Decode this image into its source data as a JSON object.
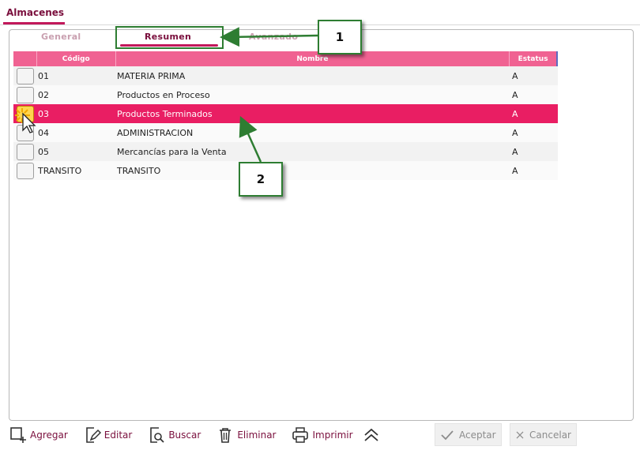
{
  "window": {
    "title": "Almacenes"
  },
  "tabs": [
    {
      "label": "General",
      "active": false
    },
    {
      "label": "Resumen",
      "active": true
    },
    {
      "label": "Avanzado",
      "active": false
    }
  ],
  "grid": {
    "headers": {
      "code": "Código",
      "name": "Nombre",
      "status": "Estatus"
    },
    "rows": [
      {
        "code": "01",
        "name": "MATERIA PRIMA",
        "status": "A",
        "selected": false
      },
      {
        "code": "02",
        "name": "Productos en Proceso",
        "status": "A",
        "selected": false
      },
      {
        "code": "03",
        "name": "Productos Terminados",
        "status": "A",
        "selected": true
      },
      {
        "code": "04",
        "name": "ADMINISTRACION",
        "status": "A",
        "selected": false
      },
      {
        "code": "05",
        "name": "Mercancías para la Venta",
        "status": "A",
        "selected": false
      },
      {
        "code": "TRANSITO",
        "name": "TRANSITO",
        "status": "A",
        "selected": false
      }
    ]
  },
  "toolbar": {
    "add_label": "Agregar",
    "edit_label": "Editar",
    "search_label": "Buscar",
    "delete_label": "Eliminar",
    "print_label": "Imprimir",
    "collapse_icon": "double-chevron-up-icon"
  },
  "actions": {
    "accept_label": "Aceptar",
    "cancel_label": "Cancelar"
  },
  "callouts": [
    {
      "label": "1"
    },
    {
      "label": "2"
    }
  ],
  "colors": {
    "accent": "#e91e63",
    "header": "#f06292",
    "brand": "#7a0f3d",
    "callout_border": "#2e7d32"
  }
}
